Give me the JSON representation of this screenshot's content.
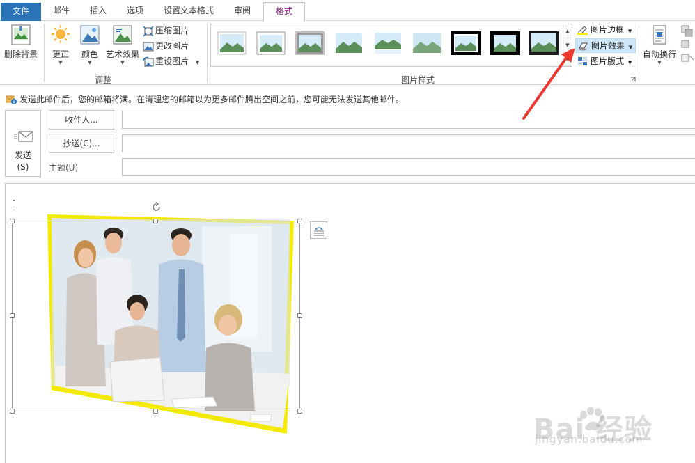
{
  "tabs": [
    {
      "label": "文件"
    },
    {
      "label": "邮件"
    },
    {
      "label": "插入"
    },
    {
      "label": "选项"
    },
    {
      "label": "设置文本格式"
    },
    {
      "label": "审阅"
    },
    {
      "label": "格式"
    }
  ],
  "ribbon": {
    "remove_bg": "删除背景",
    "correct": "更正",
    "color": "颜色",
    "art_effects": "艺术效果",
    "compress": "压缩图片",
    "change": "更改图片",
    "reset": "重设图片",
    "adjust_group": "调整",
    "styles_group": "图片样式",
    "border": "图片边框",
    "effects": "图片效果",
    "layout": "图片版式",
    "wrap": "自动换行"
  },
  "colors": {
    "accent": "#2b73b7",
    "active_tab_text": "#7a2072",
    "highlight": "#cde6f7",
    "frame_yellow": "#f3ea00",
    "arrow": "#e8382f"
  },
  "infobar": {
    "text": "发送此邮件后，您的邮箱将满。在清理您的邮箱以为更多邮件腾出空间之前，您可能无法发送其他邮件。"
  },
  "compose": {
    "send_line1": "发送",
    "send_line2": "(S)",
    "to_label": "收件人...",
    "cc_label": "抄送(C)...",
    "subject_label": "主题(U)",
    "to_value": "",
    "cc_value": "",
    "subject_value": ""
  },
  "watermark": {
    "main": "Bai  经验",
    "sub": "jingyan.baidu.com"
  }
}
